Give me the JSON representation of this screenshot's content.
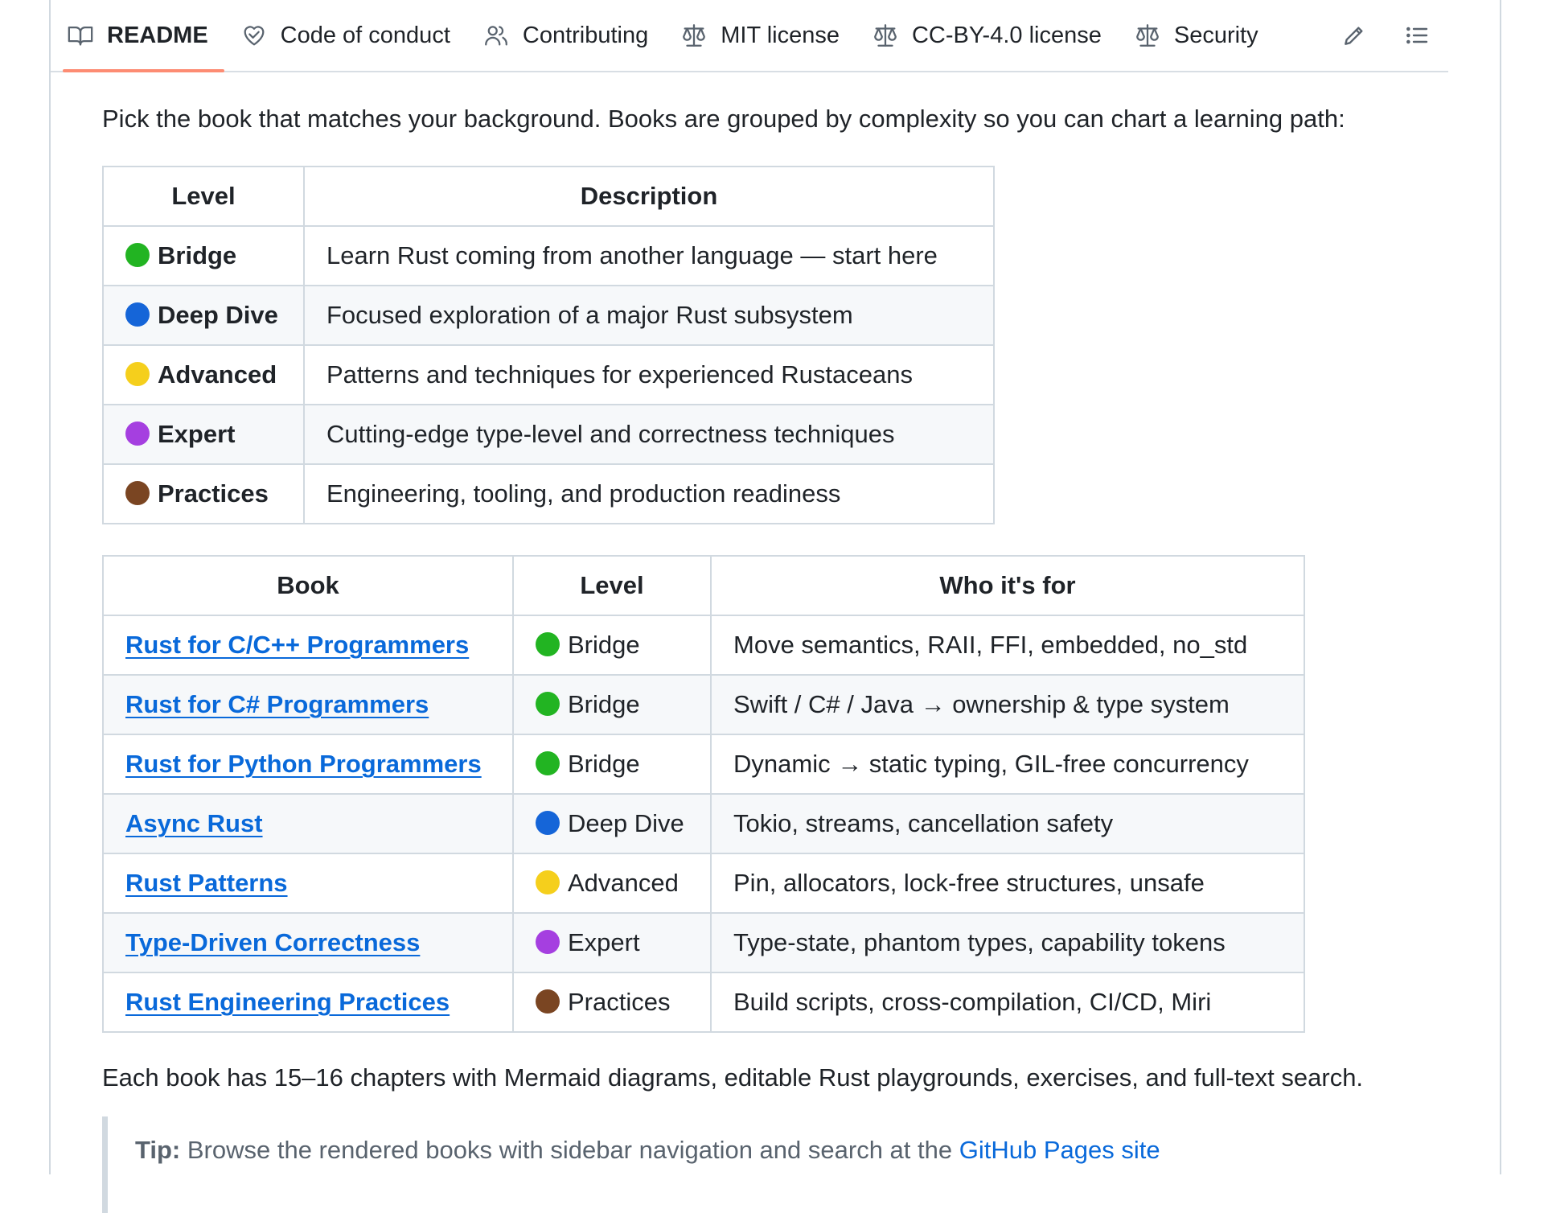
{
  "tabs": [
    {
      "label": "README",
      "icon": "book-icon",
      "active": true
    },
    {
      "label": "Code of conduct",
      "icon": "heart-handshake-icon",
      "active": false
    },
    {
      "label": "Contributing",
      "icon": "people-icon",
      "active": false
    },
    {
      "label": "MIT license",
      "icon": "law-scale-icon",
      "active": false
    },
    {
      "label": "CC-BY-4.0 license",
      "icon": "law-scale-icon",
      "active": false
    },
    {
      "label": "Security",
      "icon": "law-scale-icon",
      "active": false
    }
  ],
  "intro": "Pick the book that matches your background. Books are grouped by complexity so you can chart a learning path:",
  "levels_table": {
    "headers": [
      "Level",
      "Description"
    ],
    "rows": [
      {
        "level": "Bridge",
        "color": "#22b422",
        "description": "Learn Rust coming from another language — start here"
      },
      {
        "level": "Deep Dive",
        "color": "#1565d8",
        "description": "Focused exploration of a major Rust subsystem"
      },
      {
        "level": "Advanced",
        "color": "#f5cf1c",
        "description": "Patterns and techniques for experienced Rustaceans"
      },
      {
        "level": "Expert",
        "color": "#a53fe0",
        "description": "Cutting-edge type-level and correctness techniques"
      },
      {
        "level": "Practices",
        "color": "#7a4522",
        "description": "Engineering, tooling, and production readiness"
      }
    ]
  },
  "books_table": {
    "headers": [
      "Book",
      "Level",
      "Who it's for"
    ],
    "rows": [
      {
        "book": "Rust for C/C++ Programmers",
        "level": "Bridge",
        "color": "#22b422",
        "who": "Move semantics, RAII, FFI, embedded, no_std"
      },
      {
        "book": "Rust for C# Programmers",
        "level": "Bridge",
        "color": "#22b422",
        "who": "Swift / C# / Java → ownership & type system"
      },
      {
        "book": "Rust for Python Programmers",
        "level": "Bridge",
        "color": "#22b422",
        "who": "Dynamic → static typing, GIL-free concurrency"
      },
      {
        "book": "Async Rust",
        "level": "Deep Dive",
        "color": "#1565d8",
        "who": "Tokio, streams, cancellation safety"
      },
      {
        "book": "Rust Patterns",
        "level": "Advanced",
        "color": "#f5cf1c",
        "who": "Pin, allocators, lock-free structures, unsafe"
      },
      {
        "book": "Type-Driven Correctness",
        "level": "Expert",
        "color": "#a53fe0",
        "who": "Type-state, phantom types, capability tokens"
      },
      {
        "book": "Rust Engineering Practices",
        "level": "Practices",
        "color": "#7a4522",
        "who": "Build scripts, cross-compilation, CI/CD, Miri"
      }
    ]
  },
  "summary": "Each book has 15–16 chapters with Mermaid diagrams, editable Rust playgrounds, exercises, and full-text search.",
  "tip": {
    "label": "Tip:",
    "text": " Browse the rendered books with sidebar navigation and search at the ",
    "link": "GitHub Pages site"
  },
  "colors": {
    "accent_underline": "#fd8c73",
    "link": "#0969da"
  }
}
